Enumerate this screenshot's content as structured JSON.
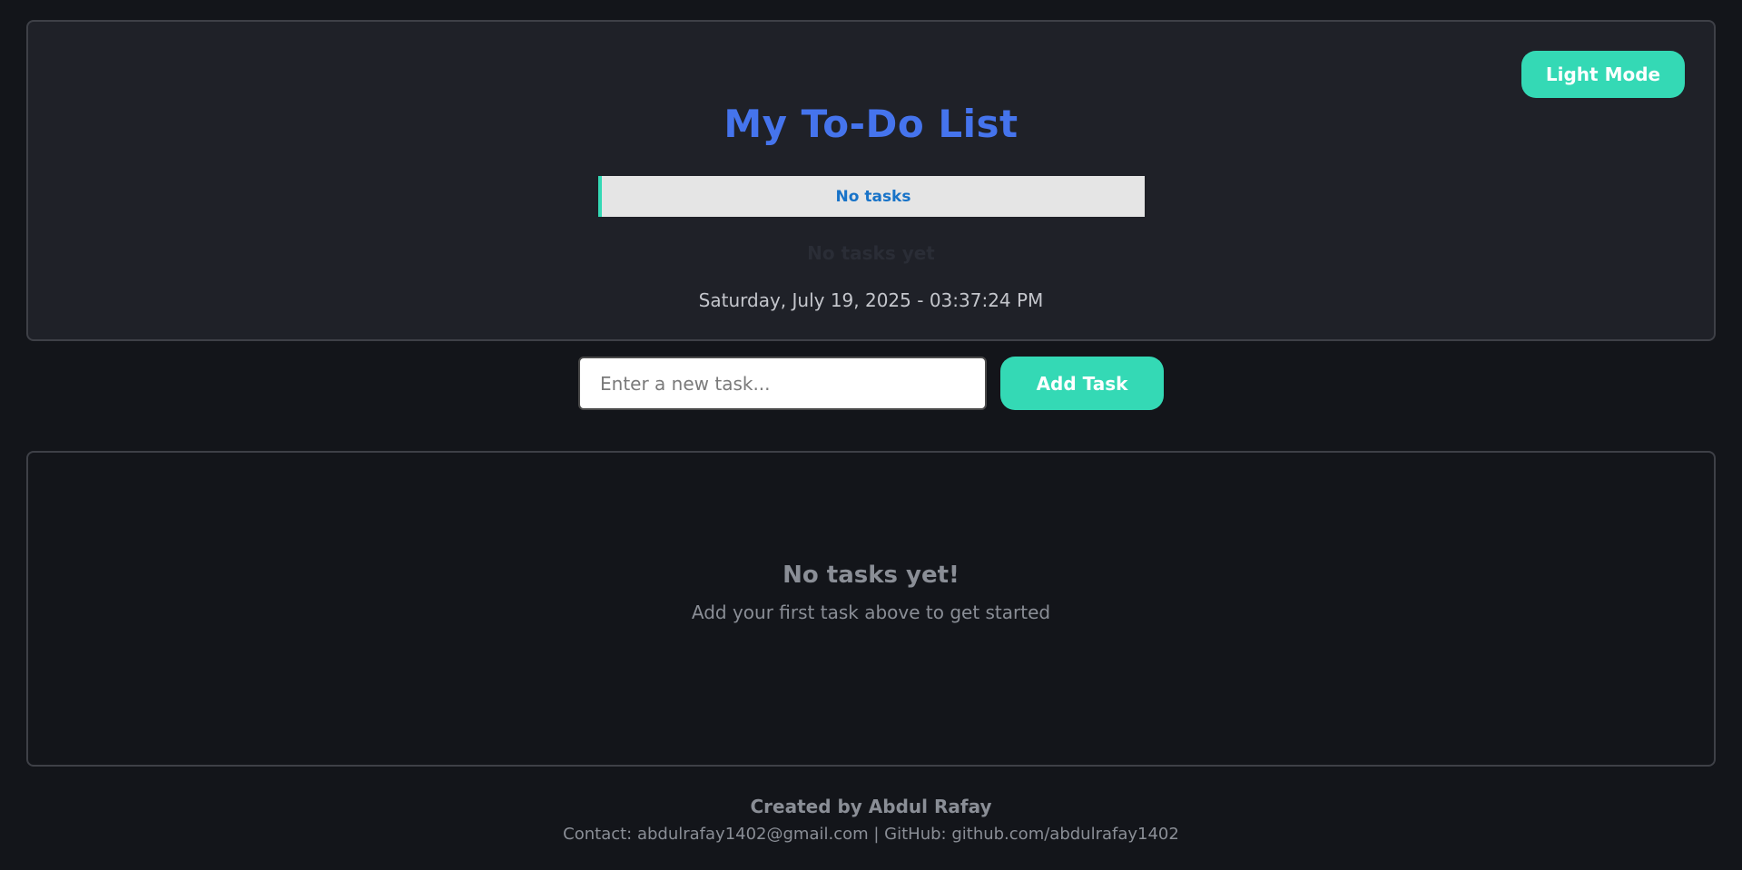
{
  "header": {
    "theme_toggle_label": "Light Mode",
    "title": "My To-Do List",
    "progress": {
      "label": "No tasks",
      "percent": 0
    },
    "stats_text": "No tasks yet",
    "datetime": "Saturday, July 19, 2025 - 03:37:24 PM"
  },
  "task_form": {
    "input_value": "",
    "input_placeholder": "Enter a new task...",
    "add_label": "Add Task"
  },
  "task_list": {
    "empty_title": "No tasks yet!",
    "empty_subtitle": "Add your first task above to get started"
  },
  "footer": {
    "credit": "Created by Abdul Rafay",
    "contact": "Contact: abdulrafay1402@gmail.com | GitHub: github.com/abdulrafay1402"
  },
  "colors": {
    "accent": "#34d9b5",
    "title": "#4574ed",
    "progress_text": "#1873c8",
    "background": "#13151a",
    "card": "#1f2128"
  }
}
